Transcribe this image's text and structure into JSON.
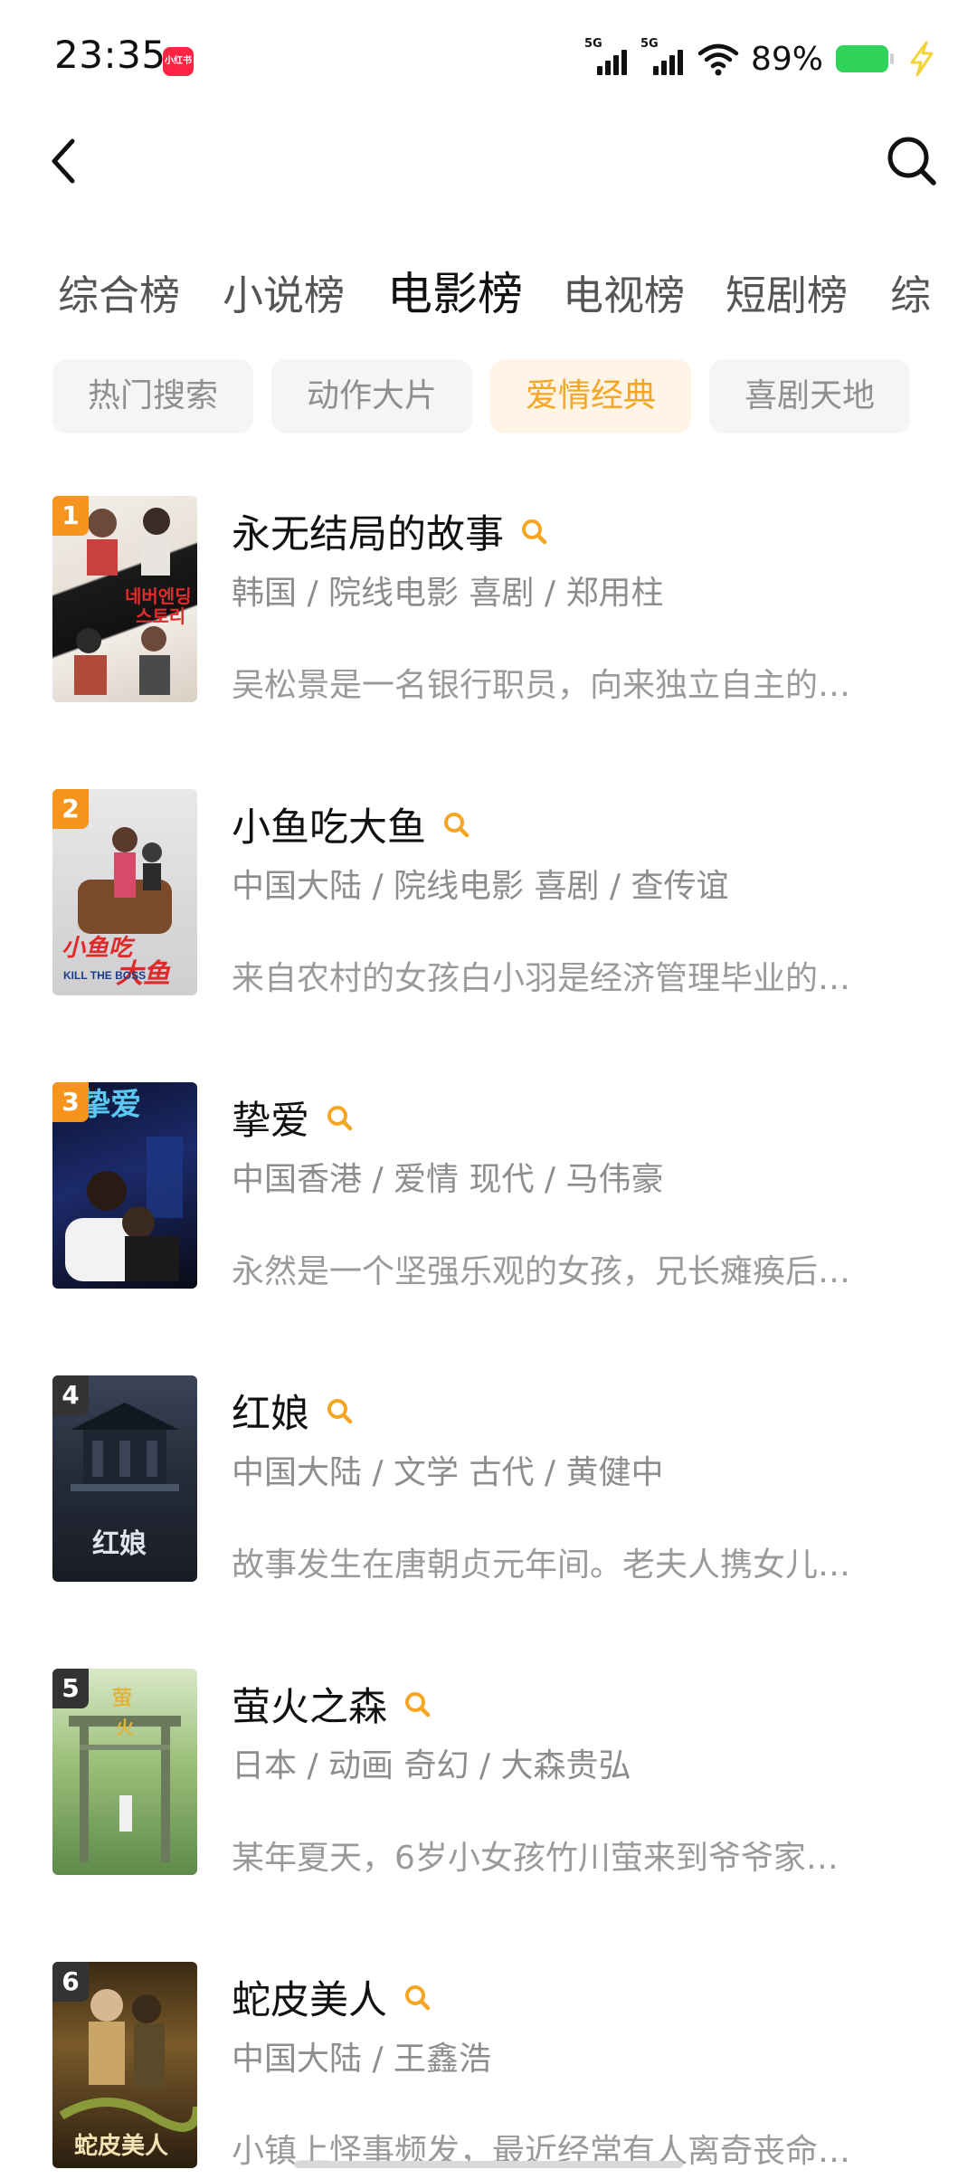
{
  "status_bar": {
    "time": "23:35",
    "app_badge": "小红书",
    "signal1": "5G",
    "signal2": "5G",
    "battery": "89%",
    "battery_level": 0.89
  },
  "nav": {
    "back_icon": "chevron-left-icon",
    "search_icon": "search-icon"
  },
  "tabs": [
    {
      "label": "综合榜"
    },
    {
      "label": "小说榜"
    },
    {
      "label": "电影榜",
      "active": true
    },
    {
      "label": "电视榜"
    },
    {
      "label": "短剧榜"
    },
    {
      "label": "综"
    }
  ],
  "chips": [
    {
      "label": "热门搜索"
    },
    {
      "label": "动作大片"
    },
    {
      "label": "爱情经典",
      "active": true
    },
    {
      "label": "喜剧天地"
    }
  ],
  "colors": {
    "accent": "#f5a623",
    "rank_top3": "#f7941d",
    "rank_other": "#333333"
  },
  "items": [
    {
      "rank": "1",
      "title": "永无结局的故事",
      "meta": "韩国 / 院线电影 喜剧 / 郑用柱",
      "desc": "吴松景是一名银行职员，向来独立自主的…"
    },
    {
      "rank": "2",
      "title": "小鱼吃大鱼",
      "meta": "中国大陆 / 院线电影 喜剧 / 查传谊",
      "desc": "来自农村的女孩白小羽是经济管理毕业的…"
    },
    {
      "rank": "3",
      "title": "挚爱",
      "meta": "中国香港 / 爱情 现代 / 马伟豪",
      "desc": "永然是一个坚强乐观的女孩，兄长瘫痪后…"
    },
    {
      "rank": "4",
      "title": "红娘",
      "meta": "中国大陆 / 文学 古代 / 黄健中",
      "desc": "故事发生在唐朝贞元年间。老夫人携女儿…"
    },
    {
      "rank": "5",
      "title": "萤火之森",
      "meta": "日本 / 动画 奇幻 / 大森贵弘",
      "desc": "某年夏天，6岁小女孩竹川萤来到爷爷家…"
    },
    {
      "rank": "6",
      "title": "蛇皮美人",
      "meta": "中国大陆 / 王鑫浩",
      "desc": "小镇上怪事频发，最近经常有人离奇丧命…"
    }
  ]
}
